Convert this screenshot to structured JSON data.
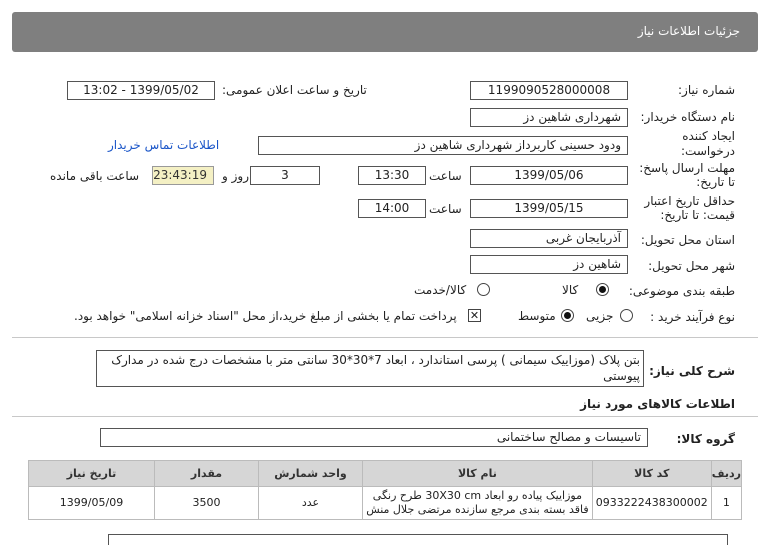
{
  "header": {
    "title": "جزئیات اطلاعات نیاز"
  },
  "form": {
    "need_number_label": "شماره نیاز:",
    "need_number": "1199090528000008",
    "announce_label": "تاریخ و ساعت اعلان عمومی:",
    "announce_value": "1399/05/02 - 13:02",
    "buyer_org_label": "نام دستگاه خریدار:",
    "buyer_org": "شهرداری شاهین دز",
    "creator_label_1": "ایجاد کننده",
    "creator_label_2": "درخواست:",
    "creator": "ودود حسینی کاربرداز شهرداری شاهین دز",
    "contact_link": "اطلاعات تماس خریدار",
    "reply_deadline_label_1": "مهلت ارسال پاسخ:",
    "reply_deadline_label_2": "تا تاریخ:",
    "reply_date": "1399/05/06",
    "time_label": "ساعت",
    "reply_time": "13:30",
    "days_value": "3",
    "days_label": "روز و",
    "remaining_time": "23:43:19",
    "remaining_label": "ساعت باقی مانده",
    "price_validity_label_1": "حداقل تاریخ اعتبار",
    "price_validity_label_2": "قیمت: تا تاریخ:",
    "validity_date": "1399/05/15",
    "validity_time": "14:00",
    "province_label": "استان محل تحویل:",
    "province": "آذربایجان غربی",
    "city_label": "شهر محل تحویل:",
    "city": "شاهین دز",
    "category_label": "طبقه بندی موضوعی:",
    "category_options": [
      "کالا",
      "کالا/خدمت"
    ],
    "process_label": "نوع فرآیند خرید :",
    "process_options": [
      "جزیی",
      "متوسط"
    ],
    "payment_note": "پرداخت تمام یا بخشی از مبلغ خرید،از محل \"اسناد خزانه اسلامی\" خواهد بود."
  },
  "summary": {
    "label": "شرح کلی نیاز:",
    "text": "بتن پلاک (موزاییک سیمانی ) پرسی استاندارد ، ابعاد 7*30*30 سانتی متر با مشخصات درج شده در مدارک پیوستی"
  },
  "goods": {
    "section_title": "اطلاعات کالاهای مورد نیاز",
    "group_label": "گروه کالا:",
    "group_value": "تاسیسات و مصالح ساختمانی",
    "columns": [
      "ردیف",
      "کد کالا",
      "نام کالا",
      "واحد شمارش",
      "مقدار",
      "تاریخ نیاز"
    ],
    "rows": [
      {
        "row": "1",
        "code": "0933222438300002",
        "name": "موزاییک پیاده رو ابعاد 30X30 cm طرح رنگی فاقد بسته بندی مرجع سازنده مرتضی جلال منش",
        "unit": "عدد",
        "qty": "3500",
        "date": "1399/05/09"
      }
    ]
  }
}
